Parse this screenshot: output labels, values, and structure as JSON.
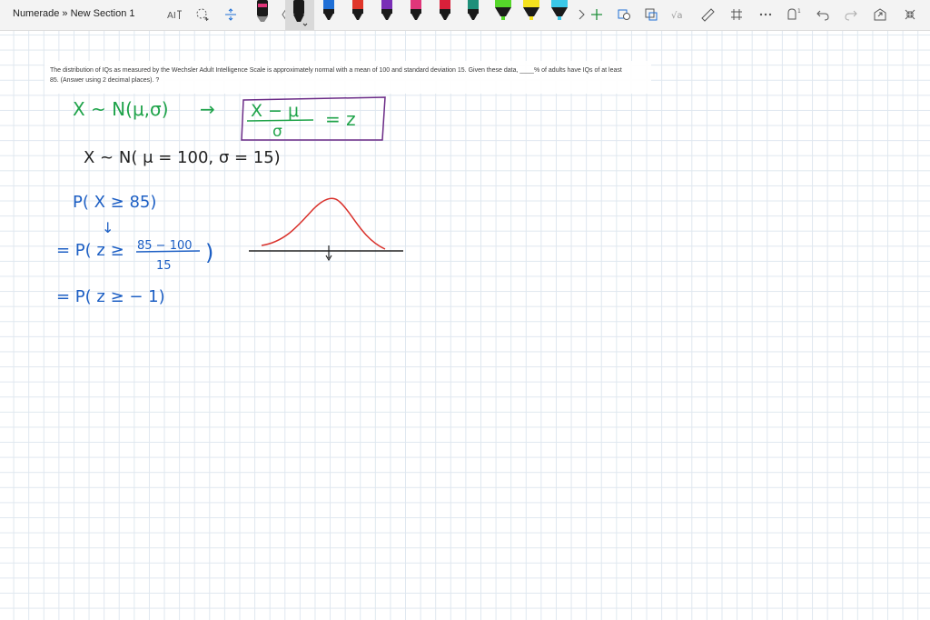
{
  "app": {
    "title": "Numerade » New Section 1"
  },
  "toolbar": {
    "tools": [
      "text-to-ink-icon",
      "lasso-select-icon",
      "insert-space-icon"
    ],
    "pens": [
      {
        "name": "pen-black",
        "color": "#1a1a1a"
      },
      {
        "name": "pen-black-selected",
        "color": "#1a1a1a"
      },
      {
        "name": "pen-blue",
        "color": "#1f6fd6"
      },
      {
        "name": "pen-red",
        "color": "#e0362a"
      },
      {
        "name": "pen-orange",
        "color": "#f07a22"
      },
      {
        "name": "pen-purple",
        "color": "#7a2fb6"
      },
      {
        "name": "pen-magenta",
        "color": "#e0367a"
      },
      {
        "name": "pen-crimson",
        "color": "#d8203a"
      },
      {
        "name": "pen-teal",
        "color": "#1f8f7a"
      },
      {
        "name": "highlighter-green",
        "color": "#55d62a"
      },
      {
        "name": "highlighter-yellow",
        "color": "#f5e21e"
      },
      {
        "name": "highlighter-cyan",
        "color": "#3ac8e8"
      }
    ],
    "right_icons": [
      "next-pens-icon",
      "add-pen-icon",
      "shape-icon",
      "ink-to-shape-icon",
      "ink-to-math-icon",
      "ruler-icon",
      "grid-icon",
      "more-icon",
      "hint-icon",
      "undo-icon",
      "redo-icon",
      "fullscreen-icon",
      "collapse-icon"
    ]
  },
  "question": {
    "text": "The distribution of IQs as measured by the Wechsler Adult Intelligence Scale is approximately normal with a mean of 100 and standard deviation 15. Given these data, ____% of adults have IQs of at least 85. (Answer using 2 decimal places). ?"
  },
  "handwriting": {
    "line1_left": "X ~ N(μ,σ)",
    "arrow": "→",
    "boxed_top": "X − μ",
    "boxed_bottom": "σ",
    "boxed_equals": "= z",
    "line2": "X ~ N( μ = 100, σ = 15)",
    "line3": "P( X ≥ 85)",
    "down_arrow": "↓",
    "line4_prefix": "= P( z ≥",
    "line4_num": "85 − 100",
    "line4_den": "15",
    "line4_suffix": ")",
    "line5": "= P( z ≥ − 1)"
  },
  "colors": {
    "green_ink": "#1fa34a",
    "blue_ink": "#1d5fc4",
    "black_ink": "#222222",
    "purple_box": "#6a2a86",
    "red_curve": "#d9302a"
  }
}
